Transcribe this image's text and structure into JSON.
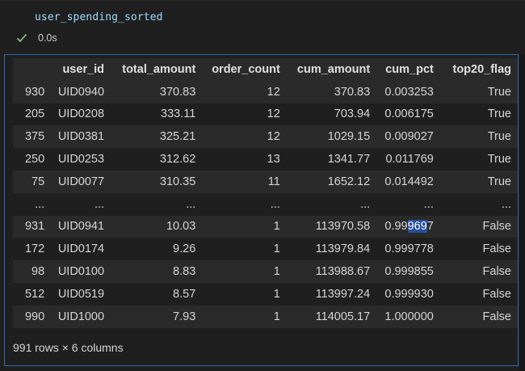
{
  "cell": {
    "code": "user_spending_sorted",
    "status_icon": "check-icon",
    "exec_time": "0.0s"
  },
  "colors": {
    "background": "#1f1f1f",
    "code_text": "#9cdcfe",
    "success_check": "#89d185",
    "frame_border": "#2c6bb8",
    "selection": "#264f9e"
  },
  "table": {
    "columns": [
      "",
      "user_id",
      "total_amount",
      "order_count",
      "cum_amount",
      "cum_pct",
      "top20_flag"
    ],
    "rows": [
      {
        "index": "930",
        "user_id": "UID0940",
        "total_amount": "370.83",
        "order_count": "12",
        "cum_amount": "370.83",
        "cum_pct": "0.003253",
        "top20_flag": "True"
      },
      {
        "index": "205",
        "user_id": "UID0208",
        "total_amount": "333.11",
        "order_count": "12",
        "cum_amount": "703.94",
        "cum_pct": "0.006175",
        "top20_flag": "True"
      },
      {
        "index": "375",
        "user_id": "UID0381",
        "total_amount": "325.21",
        "order_count": "12",
        "cum_amount": "1029.15",
        "cum_pct": "0.009027",
        "top20_flag": "True"
      },
      {
        "index": "250",
        "user_id": "UID0253",
        "total_amount": "312.62",
        "order_count": "13",
        "cum_amount": "1341.77",
        "cum_pct": "0.011769",
        "top20_flag": "True"
      },
      {
        "index": "75",
        "user_id": "UID0077",
        "total_amount": "310.35",
        "order_count": "11",
        "cum_amount": "1652.12",
        "cum_pct": "0.014492",
        "top20_flag": "True"
      },
      {
        "index": "...",
        "user_id": "...",
        "total_amount": "...",
        "order_count": "...",
        "cum_amount": "...",
        "cum_pct": "...",
        "top20_flag": "..."
      },
      {
        "index": "931",
        "user_id": "UID0941",
        "total_amount": "10.03",
        "order_count": "1",
        "cum_amount": "113970.58",
        "cum_pct_prefix": "0.99",
        "cum_pct_selected": "969",
        "cum_pct_suffix": "7",
        "top20_flag": "False"
      },
      {
        "index": "172",
        "user_id": "UID0174",
        "total_amount": "9.26",
        "order_count": "1",
        "cum_amount": "113979.84",
        "cum_pct": "0.999778",
        "top20_flag": "False"
      },
      {
        "index": "98",
        "user_id": "UID0100",
        "total_amount": "8.83",
        "order_count": "1",
        "cum_amount": "113988.67",
        "cum_pct": "0.999855",
        "top20_flag": "False"
      },
      {
        "index": "512",
        "user_id": "UID0519",
        "total_amount": "8.57",
        "order_count": "1",
        "cum_amount": "113997.24",
        "cum_pct": "0.999930",
        "top20_flag": "False"
      },
      {
        "index": "990",
        "user_id": "UID1000",
        "total_amount": "7.93",
        "order_count": "1",
        "cum_amount": "114005.17",
        "cum_pct": "1.000000",
        "top20_flag": "False"
      }
    ],
    "shape": "991 rows × 6 columns"
  }
}
